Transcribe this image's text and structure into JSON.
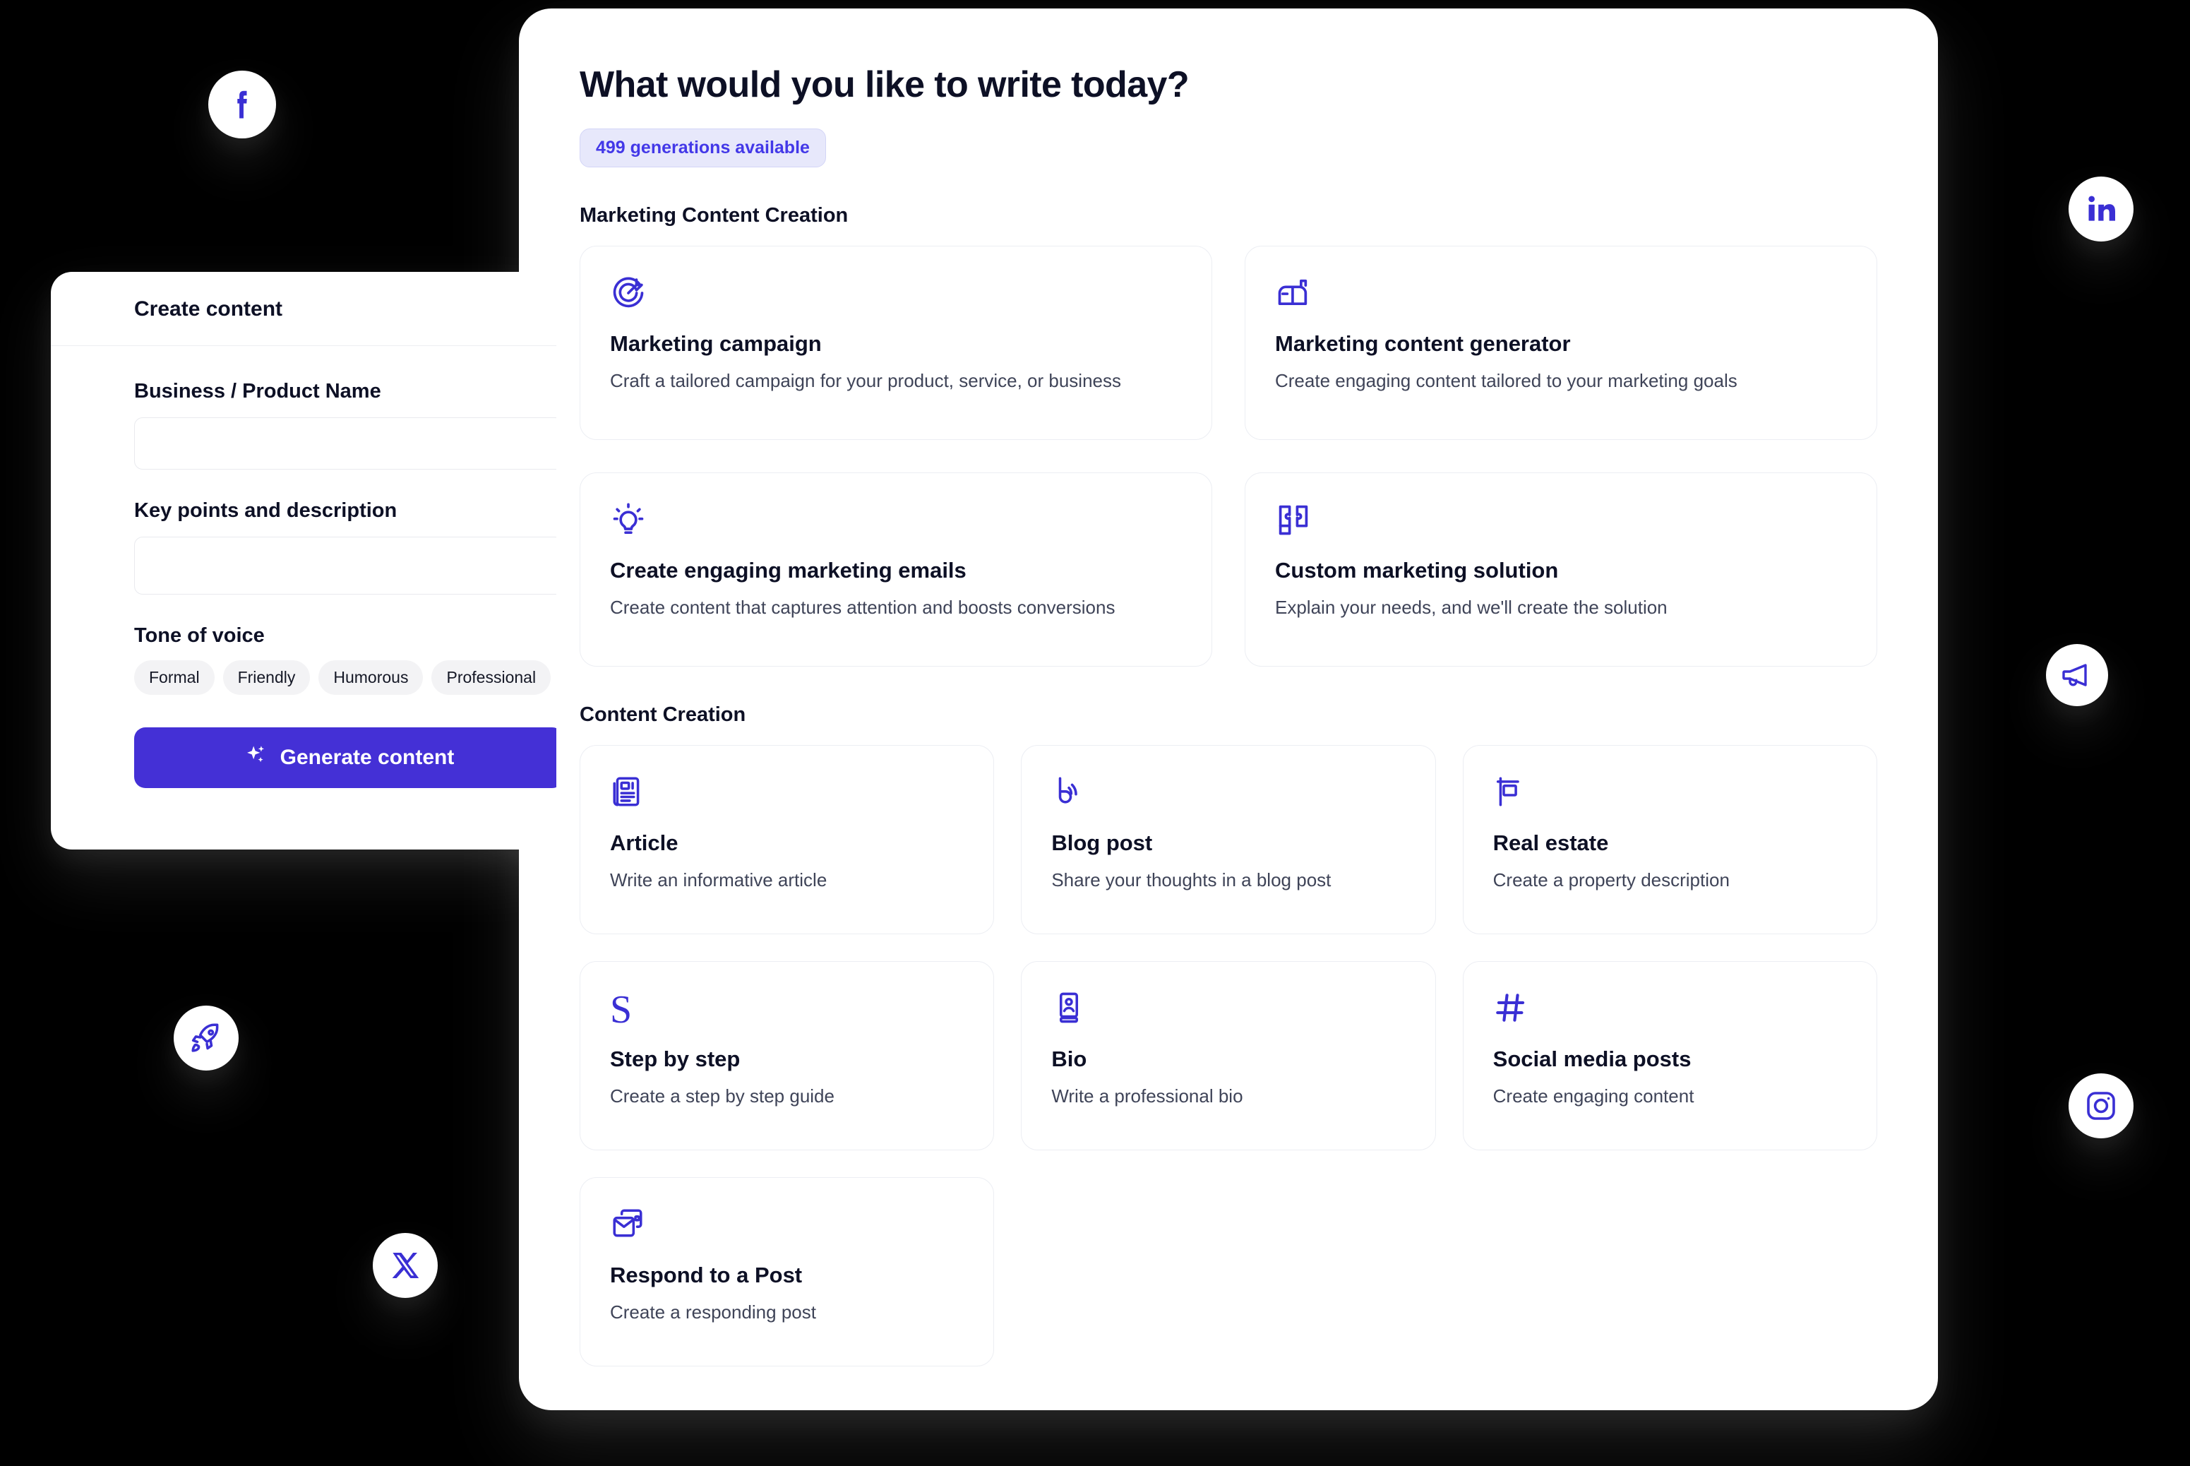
{
  "main": {
    "title": "What would you like to write today?",
    "badge": "499 generations available",
    "sections": [
      {
        "heading": "Marketing Content Creation",
        "cards": [
          {
            "icon": "target-icon",
            "title": "Marketing campaign",
            "desc": "Craft a tailored campaign for your product, service, or business"
          },
          {
            "icon": "mailbox-icon",
            "title": "Marketing content generator",
            "desc": "Create engaging content tailored to your marketing goals"
          },
          {
            "icon": "lightbulb-icon",
            "title": "Create engaging marketing emails",
            "desc": "Create content that captures attention and boosts conversions"
          },
          {
            "icon": "puzzle-icon",
            "title": "Custom marketing solution",
            "desc": "Explain your needs, and we'll create the solution"
          }
        ]
      },
      {
        "heading": "Content Creation",
        "cards": [
          {
            "icon": "newspaper-icon",
            "title": "Article",
            "desc": "Write an informative article"
          },
          {
            "icon": "blog-rss-icon",
            "title": "Blog post",
            "desc": "Share your thoughts in a blog post"
          },
          {
            "icon": "yard-sign-icon",
            "title": "Real estate",
            "desc": "Create a property description"
          },
          {
            "icon": "letter-s-icon",
            "title": "Step by step",
            "desc": "Create a step by step guide"
          },
          {
            "icon": "contact-card-icon",
            "title": "Bio",
            "desc": "Write a professional bio"
          },
          {
            "icon": "hashtag-icon",
            "title": "Social media posts",
            "desc": "Create engaging content"
          },
          {
            "icon": "mail-reply-icon",
            "title": "Respond to a Post",
            "desc": "Create a responding post"
          }
        ]
      }
    ]
  },
  "create_panel": {
    "title": "Create content",
    "fields": [
      {
        "label": "Business / Product Name",
        "value": "",
        "placeholder": ""
      },
      {
        "label": "Key points and description",
        "value": "",
        "placeholder": ""
      }
    ],
    "tone_label": "Tone of voice",
    "tone_options": [
      "Formal",
      "Friendly",
      "Humorous",
      "Professional"
    ],
    "generate_label": "Generate content"
  },
  "floating_icons": [
    {
      "name": "facebook-icon",
      "label": "Facebook"
    },
    {
      "name": "linkedin-icon",
      "label": "LinkedIn"
    },
    {
      "name": "megaphone-icon",
      "label": "Megaphone"
    },
    {
      "name": "rocket-icon",
      "label": "Rocket"
    },
    {
      "name": "instagram-icon",
      "label": "Instagram"
    },
    {
      "name": "x-twitter-icon",
      "label": "X"
    }
  ],
  "colors": {
    "accent": "#4430d6",
    "icon_purple": "#3a2fd4",
    "badge_bg": "#e7e8fb",
    "badge_text": "#4338e8",
    "background": "#000000",
    "surface": "#ffffff"
  }
}
